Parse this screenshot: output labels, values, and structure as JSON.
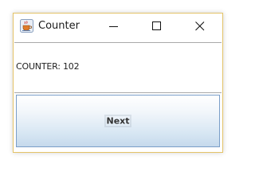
{
  "window": {
    "title": "Counter",
    "icon": "java-cup-icon",
    "controls": {
      "minimize": "minimize-icon",
      "maximize": "maximize-icon",
      "close": "close-icon"
    }
  },
  "counter": {
    "label": "COUNTER: 102"
  },
  "actions": {
    "next_label": "Next"
  },
  "colors": {
    "window_border": "#e4c368",
    "button_border": "#7a9ec8",
    "button_gradient_bottom": "#c5d9ec"
  }
}
